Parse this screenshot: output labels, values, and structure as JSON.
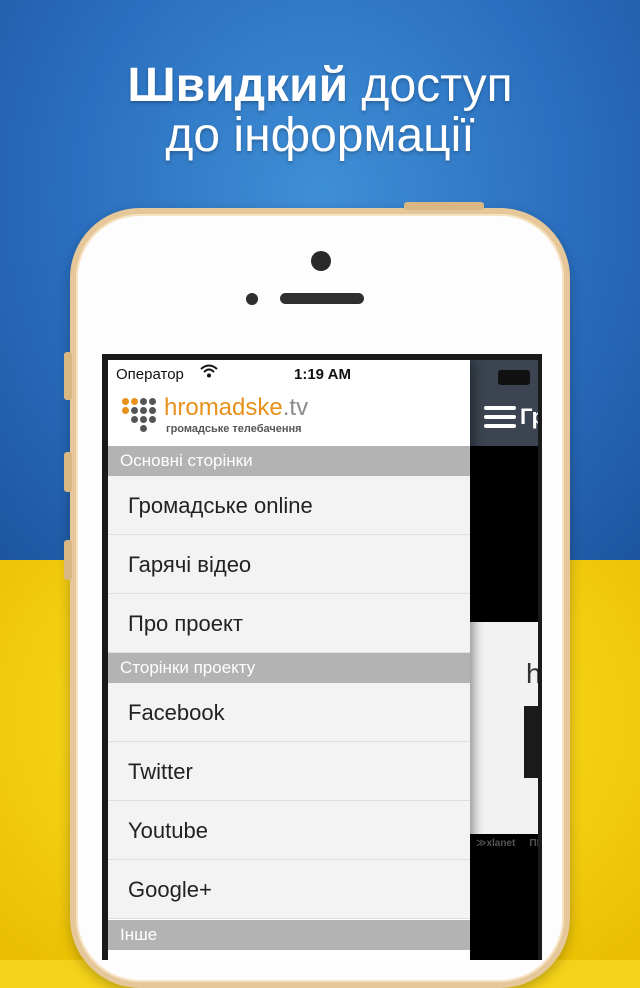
{
  "headline": {
    "line1_bold": "Швидкий",
    "line1_rest": " доступ",
    "line2": "до інформації"
  },
  "status_bar": {
    "carrier": "Оператор",
    "time": "1:19 AM"
  },
  "brand": {
    "name_main": "hromadske",
    "name_suffix": ".tv",
    "subtitle": "громадське телебачення"
  },
  "menu": {
    "sections": [
      {
        "title": "Основні сторінки",
        "items": [
          "Громадське online",
          "Гарячі відео",
          "Про проект"
        ]
      },
      {
        "title": "Сторінки проекту",
        "items": [
          "Facebook",
          "Twitter",
          "Youtube",
          "Google+"
        ]
      },
      {
        "title": "Інше",
        "items": []
      }
    ]
  },
  "behind_app": {
    "title_fragment": "Гр",
    "content_letter": "h",
    "logo_text_1": "≫xlanet",
    "logo_text_2": "ПІ"
  },
  "colors": {
    "flag_blue": "#2a6fbf",
    "flag_yellow": "#f3cf12",
    "brand_orange": "#e8901c",
    "section_gray": "#b3b3b3",
    "phone_gold": "#e6c79a"
  }
}
